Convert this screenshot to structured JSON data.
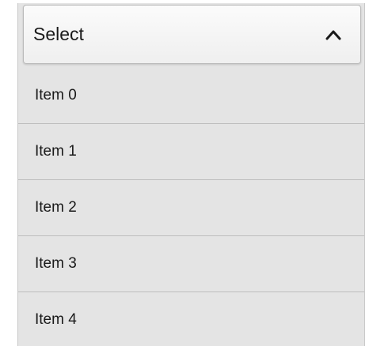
{
  "select": {
    "label": "Select",
    "expanded": true,
    "icon": "chevron-up-icon"
  },
  "items": [
    {
      "label": "Item 0"
    },
    {
      "label": "Item 1"
    },
    {
      "label": "Item 2"
    },
    {
      "label": "Item 3"
    },
    {
      "label": "Item 4"
    }
  ],
  "colors": {
    "header_bg": "#f5f5f5",
    "list_bg": "#e4e4e4",
    "divider": "#bdbdbd",
    "text": "#1a1a1a"
  }
}
